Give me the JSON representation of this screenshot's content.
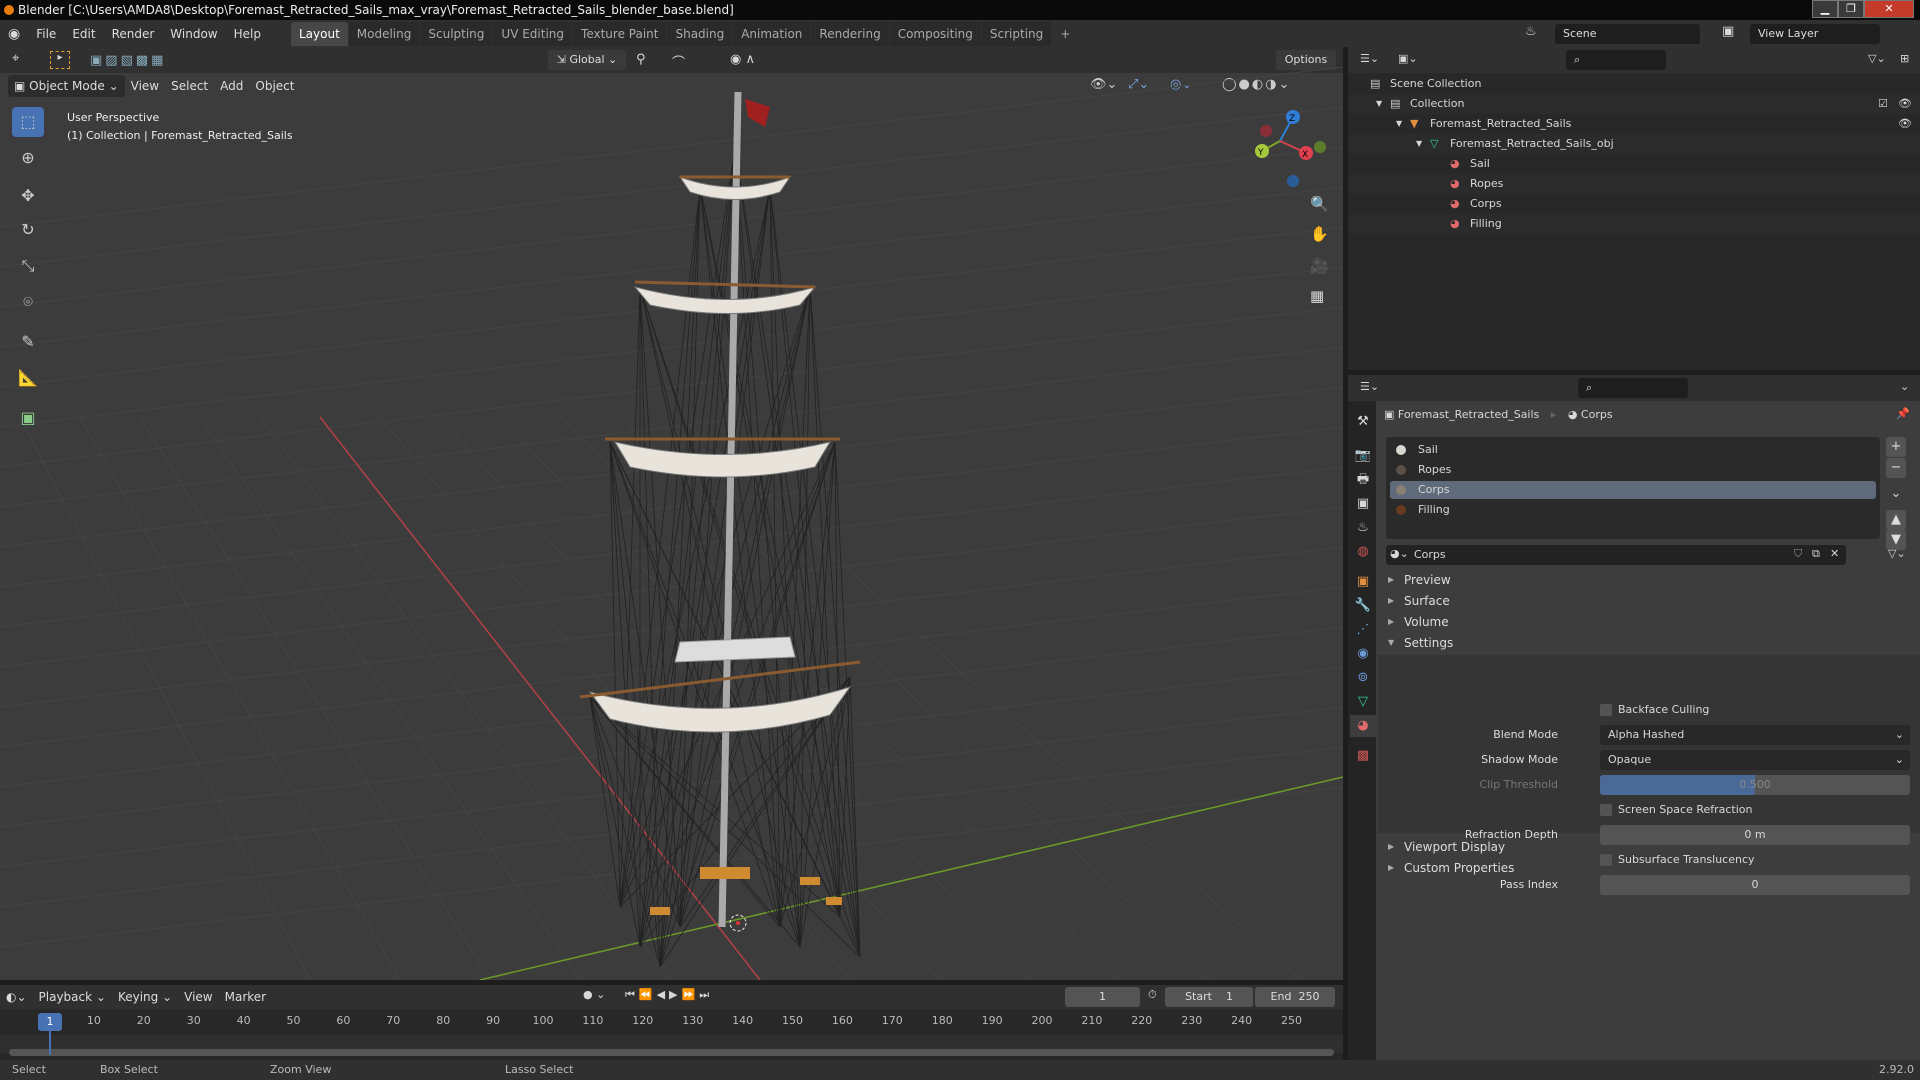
{
  "window": {
    "title": "Blender [C:\\Users\\AMDA8\\Desktop\\Foremast_Retracted_Sails_max_vray\\Foremast_Retracted_Sails_blender_base.blend]",
    "minimize": "▁",
    "maximize": "❐",
    "close": "✕"
  },
  "menu": [
    "File",
    "Edit",
    "Render",
    "Window",
    "Help"
  ],
  "workspaces": [
    "Layout",
    "Modeling",
    "Sculpting",
    "UV Editing",
    "Texture Paint",
    "Shading",
    "Animation",
    "Rendering",
    "Compositing",
    "Scripting",
    "+"
  ],
  "scene": {
    "label": "Scene",
    "view_layer": "View Layer"
  },
  "viewport": {
    "orientation": "Global",
    "options": "Options",
    "mode": "Object Mode",
    "menus": [
      "View",
      "Select",
      "Add",
      "Object"
    ],
    "info_line1": "User Perspective",
    "info_line2": "(1) Collection | Foremast_Retracted_Sails",
    "gizmo": {
      "z": "Z",
      "y": "Y",
      "x": "X"
    }
  },
  "outliner": {
    "items": [
      {
        "label": "Scene Collection",
        "depth": 0
      },
      {
        "label": "Collection",
        "depth": 1
      },
      {
        "label": "Foremast_Retracted_Sails",
        "depth": 2
      },
      {
        "label": "Foremast_Retracted_Sails_obj",
        "depth": 3
      },
      {
        "label": "Sail",
        "depth": 4
      },
      {
        "label": "Ropes",
        "depth": 4
      },
      {
        "label": "Corps",
        "depth": 4
      },
      {
        "label": "Filling",
        "depth": 4
      }
    ]
  },
  "properties": {
    "breadcrumb_object": "Foremast_Retracted_Sails",
    "breadcrumb_material": "Corps",
    "slots": [
      {
        "label": "Sail",
        "color": "#d8d8d0"
      },
      {
        "label": "Ropes",
        "color": "#5a5048"
      },
      {
        "label": "Corps",
        "color": "#888070"
      },
      {
        "label": "Filling",
        "color": "#6a3a20"
      }
    ],
    "selected_slot": "Corps",
    "material_name": "Corps",
    "sections": {
      "preview": "Preview",
      "surface": "Surface",
      "volume": "Volume",
      "settings": "Settings",
      "viewport_display": "Viewport Display",
      "custom_properties": "Custom Properties"
    },
    "settings": {
      "backface_culling": "Backface Culling",
      "backface_culling_checked": false,
      "blend_mode_label": "Blend Mode",
      "blend_mode": "Alpha Hashed",
      "shadow_mode_label": "Shadow Mode",
      "shadow_mode": "Opaque",
      "clip_threshold_label": "Clip Threshold",
      "clip_threshold": "0.500",
      "clip_fraction": 0.5,
      "ssr": "Screen Space Refraction",
      "refraction_depth_label": "Refraction Depth",
      "refraction_depth": "0 m",
      "subsurface": "Subsurface Translucency",
      "pass_index_label": "Pass Index",
      "pass_index": "0"
    }
  },
  "timeline": {
    "menus": [
      "Playback",
      "Keying",
      "View",
      "Marker"
    ],
    "current_frame": "1",
    "start_label": "Start",
    "start": "1",
    "end_label": "End",
    "end": "250",
    "ticks": [
      1,
      10,
      20,
      30,
      40,
      50,
      60,
      70,
      80,
      90,
      100,
      110,
      120,
      130,
      140,
      150,
      160,
      170,
      180,
      190,
      200,
      210,
      220,
      230,
      240,
      250
    ]
  },
  "status": {
    "select": "Select",
    "box_select": "Box Select",
    "zoom_view": "Zoom View",
    "lasso_select": "Lasso Select",
    "version": "2.92.0"
  },
  "colors": {
    "accent": "#4772b3",
    "x_axis": "#d0434f",
    "y_axis": "#7fa52e",
    "z_axis": "#2f7fd8"
  }
}
